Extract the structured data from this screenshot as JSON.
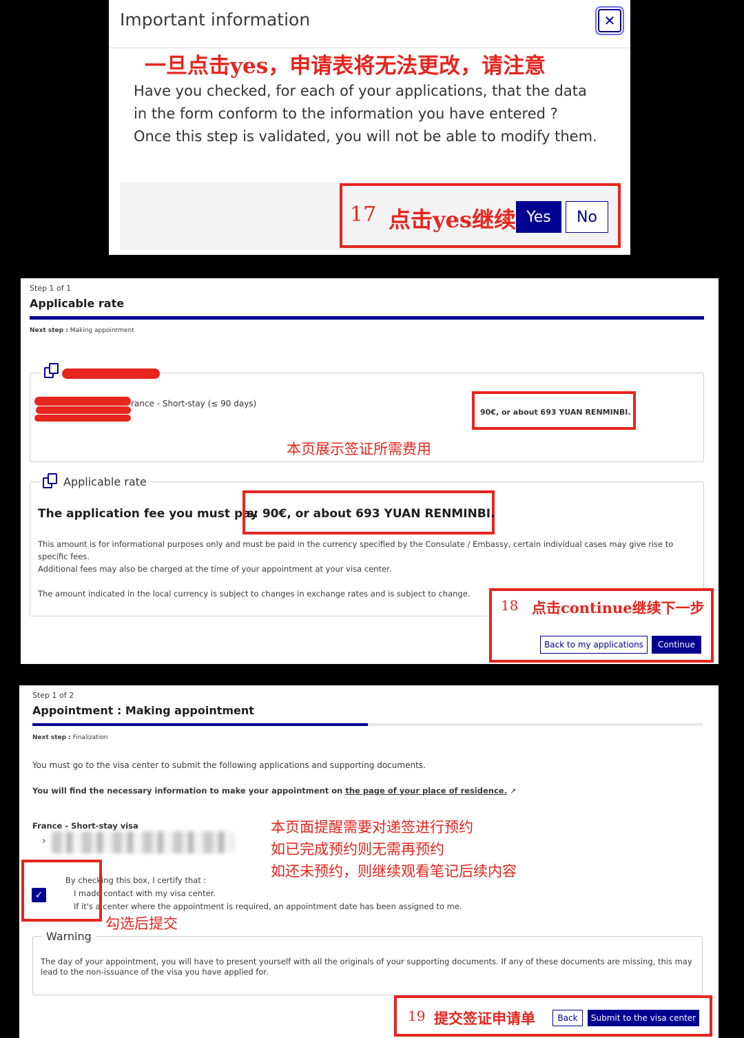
{
  "dialog": {
    "title": "Important information",
    "annotation_top": "一旦点击yes，申请表将无法更改，请注意",
    "message_line1": "Have you checked, for each of your applications, that the data",
    "message_line2": "in the form  conform to the information you have entered ?",
    "message_line3": "Once this step is validated, you will not be able to modify them.",
    "step_number": "17",
    "annotation_step": "点击yes继续",
    "yes_label": "Yes",
    "no_label": "No"
  },
  "rate_page": {
    "step_indicator": "Step 1 of 1",
    "title": "Applicable rate",
    "next_step_label": "Next step :",
    "next_step_value": "Making appointment",
    "application_line": "rance - Short-stay (≤ 90 days)",
    "application_fee_small": "90€, or about 693 YUAN RENMINBI.",
    "annotation_fee": "本页展示签证所需费用",
    "rate_legend": "Applicable rate",
    "fee_prefix": "The application fee you must pay",
    "fee_amount": "s:  90€, or about 693 YUAN RENMINBI.",
    "info_line1": "This amount is for informational purposes only and must be paid in the currency specified by the Consulate / Embassy, certain individual cases may give rise to",
    "info_line2": "specific fees.",
    "info_line3": "Additional fees may also be charged at the time of your appointment at your visa center.",
    "info_line4": "The amount indicated in the local currency is subject to changes in exchange rates and is subject to change.",
    "step_number": "18",
    "annotation_step": "点击continue继续下一步",
    "back_label": "Back to my applications",
    "continue_label": "Continue"
  },
  "appointment_page": {
    "step_indicator": "Step 1 of 2",
    "title": "Appointment : Making appointment",
    "next_step_label": "Next step :",
    "next_step_value": "Finalization",
    "intro": "You must go to the visa center to submit the following applications and supporting documents.",
    "find_info_prefix": "You will find the necessary information to make your appointment on",
    "find_info_link": "the page of your place of residence.",
    "visa_label": "France - Short-stay visa",
    "annotation_line1": "本页面提醒需要对递签进行预约",
    "annotation_line2": "如已完成预约则无需再预约",
    "annotation_line3": "如还未预约，则继续观看笔记后续内容",
    "certify_intro": "By checking this box, I certify that :",
    "certify_line1": "I made contact with my visa center.",
    "certify_line2": "If it's a center where the appointment is required, an appointment date has been assigned to me.",
    "annotation_check": "勾选后提交",
    "warning_legend": "Warning",
    "warning_text1": "The day of your appointment, you will have to present yourself with all the originals of your supporting documents. If any of these documents are missing, this may",
    "warning_text2": "lead to the non-issuance of the visa you have applied for.",
    "step_number": "19",
    "annotation_step": "提交签证申请单",
    "back_label": "Back",
    "submit_label": "Submit to the visa center",
    "progress": 0.5
  },
  "colors": {
    "primary": "#000091",
    "annotation_red": "#e5251e",
    "border": "#cfcfcf"
  }
}
